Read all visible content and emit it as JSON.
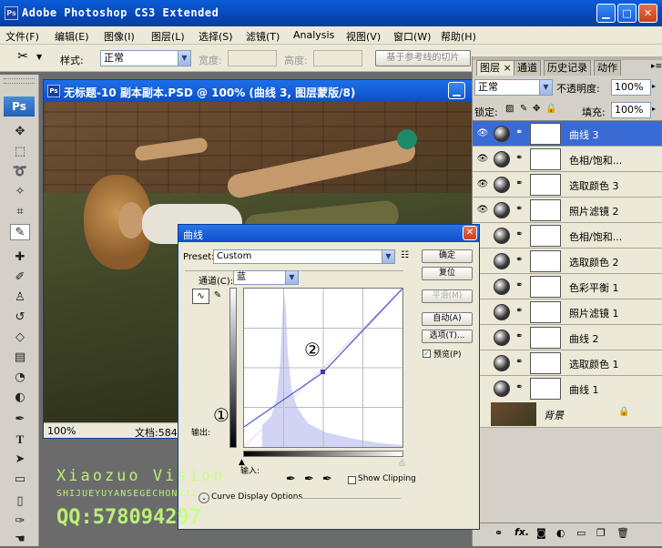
{
  "app": {
    "title": "Adobe Photoshop CS3 Extended",
    "logo": "Ps"
  },
  "window_controls": [
    "minimize",
    "maximize",
    "close"
  ],
  "menu": [
    "文件(F)",
    "编辑(E)",
    "图像(I)",
    "图层(L)",
    "选择(S)",
    "滤镜(T)",
    "Analysis",
    "视图(V)",
    "窗口(W)",
    "帮助(H)"
  ],
  "options": {
    "style_label": "样式:",
    "style_value": "正常",
    "width_label": "宽度:",
    "height_label": "高度:",
    "based_on_guides": "基于参考线的切片"
  },
  "document": {
    "title": "无标题-10 副本副本.PSD @ 100% (曲线 3, 图层蒙版/8)",
    "zoom": "100%",
    "doc_label": "文档:584"
  },
  "panel": {
    "tabs": [
      "图层",
      "通道",
      "历史记录",
      "动作"
    ],
    "close_x": "×",
    "blend_mode": "正常",
    "opacity_label": "不透明度:",
    "opacity_value": "100%",
    "lock_label": "锁定:",
    "fill_label": "填充:",
    "fill_value": "100%",
    "layers": [
      {
        "name": "曲线 3",
        "visible": true,
        "selected": true
      },
      {
        "name": "色相/饱和...",
        "visible": true,
        "selected": false
      },
      {
        "name": "选取颜色 3",
        "visible": true,
        "selected": false
      },
      {
        "name": "照片滤镜 2",
        "visible": true,
        "selected": false
      },
      {
        "name": "色相/饱和...",
        "visible": false,
        "selected": false
      },
      {
        "name": "选取颜色 2",
        "visible": false,
        "selected": false
      },
      {
        "name": "色彩平衡 1",
        "visible": false,
        "selected": false
      },
      {
        "name": "照片滤镜 1",
        "visible": false,
        "selected": false
      },
      {
        "name": "曲线 2",
        "visible": false,
        "selected": false
      },
      {
        "name": "选取颜色 1",
        "visible": false,
        "selected": false
      },
      {
        "name": "曲线 1",
        "visible": false,
        "selected": false
      }
    ],
    "background_layer": "背景",
    "bottom_icons": [
      "link-icon",
      "fx-icon",
      "mask-icon",
      "adjustment-icon",
      "group-icon",
      "new-layer-icon",
      "trash-icon"
    ]
  },
  "curves": {
    "title": "曲线",
    "preset_label": "Preset:",
    "preset_value": "Custom",
    "channel_label": "通道(C):",
    "channel_value": "蓝",
    "buttons": {
      "ok": "确定",
      "reset": "复位",
      "smooth": "平滑(M)",
      "auto": "自动(A)",
      "options": "选项(T)..."
    },
    "preview_label": "预览(P)",
    "preview_checked": true,
    "output_label": "输出:",
    "input_label": "输入:",
    "show_clipping": "Show Clipping",
    "curve_display_options": "Curve Display Options",
    "marker_1": "①",
    "marker_2": "②"
  },
  "watermark": {
    "line1": "Xiaozuo Vision",
    "line2": "SHIJUEYUYANSEGECHONGJI",
    "line3": "QQ:578094297"
  }
}
